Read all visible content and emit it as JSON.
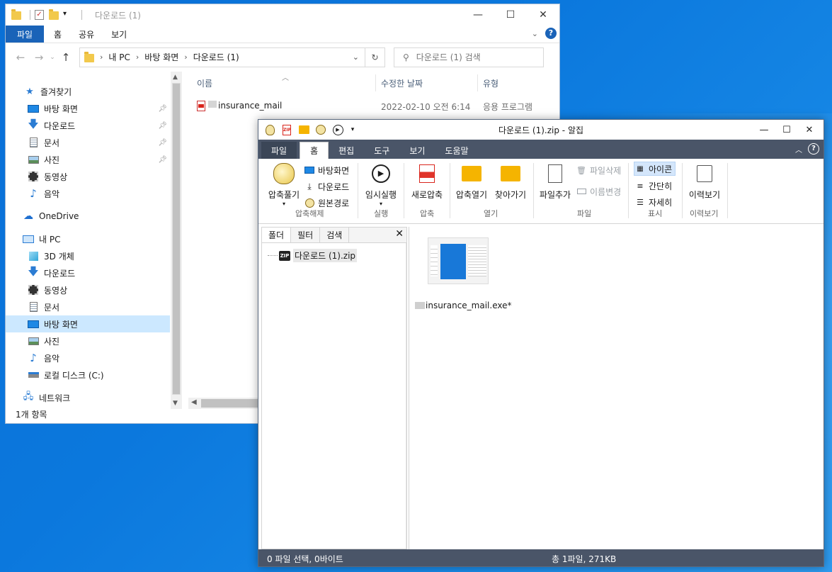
{
  "explorer": {
    "title": "다운로드 (1)",
    "menu": {
      "file": "파일",
      "home": "홈",
      "share": "공유",
      "view": "보기"
    },
    "address": {
      "seg1": "내 PC",
      "seg2": "바탕 화면",
      "seg3": "다운로드 (1)"
    },
    "search_placeholder": "다운로드 (1) 검색",
    "nav": {
      "favorites": "즐겨찾기",
      "fav_items": [
        "바탕 화면",
        "다운로드",
        "문서",
        "사진",
        "동영상",
        "음악"
      ],
      "onedrive": "OneDrive",
      "thispc": "내 PC",
      "pc_items": [
        "3D 개체",
        "다운로드",
        "동영상",
        "문서",
        "바탕 화면",
        "사진",
        "음악",
        "로컬 디스크 (C:)"
      ],
      "network": "네트워크"
    },
    "columns": {
      "name": "이름",
      "modified": "수정한 날짜",
      "type": "유형"
    },
    "files": [
      {
        "name": "insurance_mail",
        "modified": "2022-02-10 오전 6:14",
        "type": "응용 프로그램"
      }
    ],
    "status": "1개 항목"
  },
  "alzip": {
    "title": "다운로드 (1).zip - 알집",
    "tabs": [
      "파일",
      "홈",
      "편집",
      "도구",
      "보기",
      "도움말"
    ],
    "ribbon": {
      "extract_btn": "압축풀기",
      "to_desktop": "바탕화면",
      "to_downloads": "다운로드",
      "to_origin": "원본경로",
      "grp_extract": "압축해제",
      "run_temp": "임시실행",
      "grp_run": "실행",
      "new_zip": "새로압축",
      "grp_zip": "압축",
      "open_zip": "압축열기",
      "goto": "찾아가기",
      "grp_open": "열기",
      "add_file": "파일추가",
      "delete_file": "파일삭제",
      "rename": "이름변경",
      "grp_file": "파일",
      "view_icon": "아이콘",
      "view_simple": "간단히",
      "view_detail": "자세히",
      "grp_view": "표시",
      "history": "이력보기",
      "grp_history": "이력보기"
    },
    "folder_pane": {
      "tabs": [
        "폴더",
        "필터",
        "검색"
      ],
      "tree_item": "다운로드 (1).zip"
    },
    "file_view": {
      "file_name": "insurance_mail.exe*"
    },
    "status": {
      "left": "0 파일 선택,  0바이트",
      "center": "총 1파일,  271KB"
    }
  }
}
